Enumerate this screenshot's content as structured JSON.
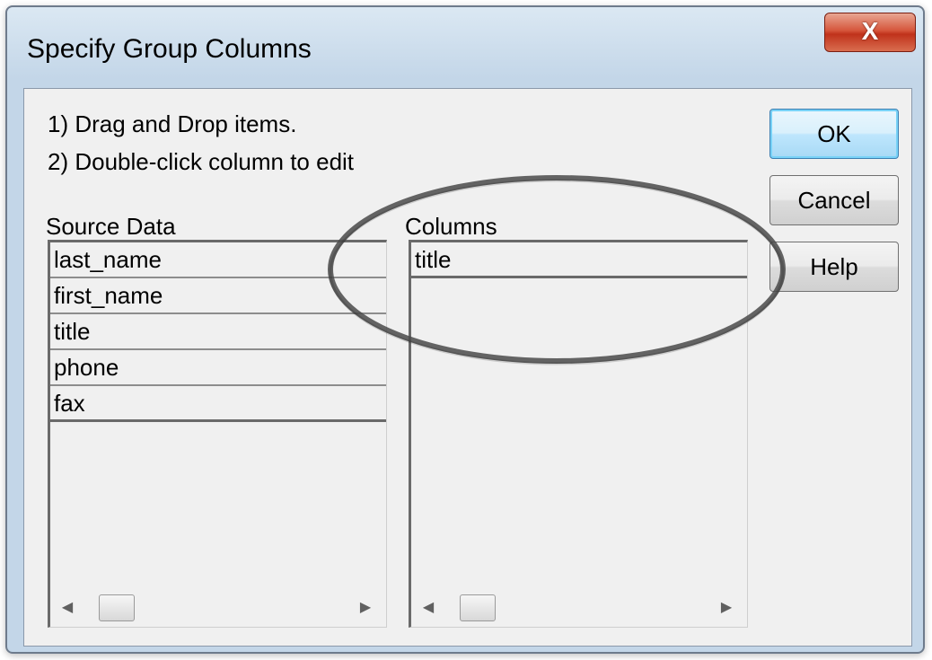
{
  "window": {
    "title": "Specify Group Columns",
    "close_label": "X"
  },
  "instructions": {
    "line1": "1) Drag and Drop items.",
    "line2": "2) Double-click column to edit"
  },
  "buttons": {
    "ok": "OK",
    "cancel": "Cancel",
    "help": "Help"
  },
  "source_data": {
    "label": "Source Data",
    "items": [
      "last_name",
      "first_name",
      "title",
      "phone",
      "fax"
    ]
  },
  "columns": {
    "label": "Columns",
    "items": [
      "title"
    ]
  },
  "scrollbar": {
    "left_arrow": "◀",
    "right_arrow": "▶"
  },
  "colors": {
    "dialog_bg": "#f0f0f0",
    "close_button": "#c0321b",
    "default_button_border": "#3c7fb1"
  }
}
